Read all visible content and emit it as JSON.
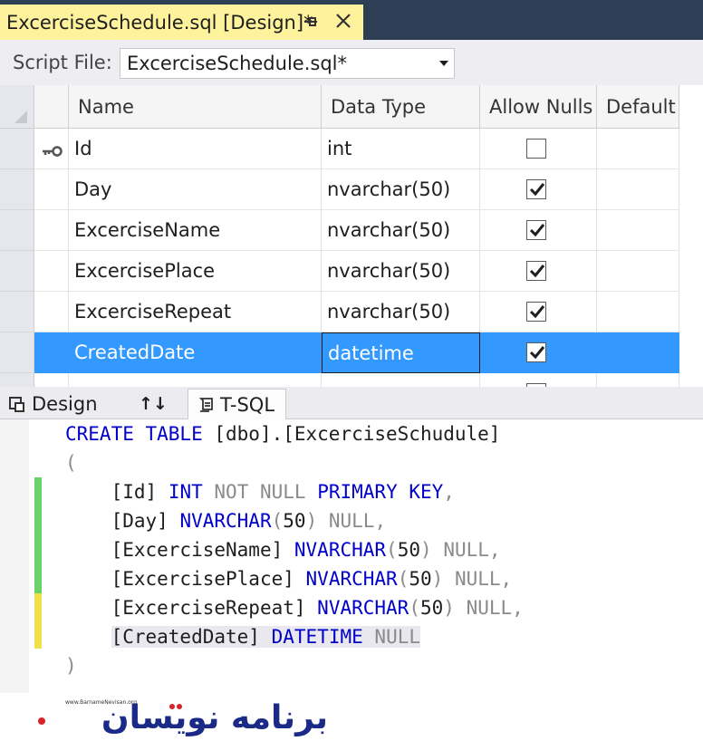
{
  "tab": {
    "title": "ExcerciseSchedule.sql [Design]*"
  },
  "script_file": {
    "label": "Script File:",
    "value": "ExcerciseSchedule.sql*"
  },
  "grid": {
    "columns": [
      "Name",
      "Data Type",
      "Allow Nulls",
      "Default"
    ],
    "rows": [
      {
        "name": "Id",
        "type": "int",
        "allow_nulls": false,
        "primary_key": true
      },
      {
        "name": "Day",
        "type": "nvarchar(50)",
        "allow_nulls": true
      },
      {
        "name": "ExcerciseName",
        "type": "nvarchar(50)",
        "allow_nulls": true
      },
      {
        "name": "ExcercisePlace",
        "type": "nvarchar(50)",
        "allow_nulls": true
      },
      {
        "name": "ExcerciseRepeat",
        "type": "nvarchar(50)",
        "allow_nulls": true
      },
      {
        "name": "CreatedDate",
        "type": "datetime",
        "allow_nulls": true,
        "selected": true
      }
    ]
  },
  "pane_tabs": {
    "design": "Design",
    "swap": "↑↓",
    "tsql": "T-SQL"
  },
  "sql": {
    "l1_kw": "CREATE TABLE",
    "l1_rest": "[dbo].[ExcerciseSchudule]",
    "l2": "(",
    "l3_col": "[Id]",
    "l3_type": "INT",
    "l3_null": "NOT NULL",
    "l3_pk": "PRIMARY KEY",
    "l3_end": ",",
    "l4_col": "[Day]",
    "l4_type": "NVARCHAR",
    "l4_len": "50",
    "l5_col": "[ExcerciseName]",
    "l5_type": "NVARCHAR",
    "l5_len": "50",
    "l6_col": "[ExcercisePlace]",
    "l6_type": "NVARCHAR",
    "l6_len": "50",
    "l7_col": "[ExcerciseRepeat]",
    "l7_type": "NVARCHAR",
    "l7_len": "50",
    "l8_col": "[CreatedDate]",
    "l8_type": "DATETIME",
    "l8_null": "NULL",
    "null_kw": "NULL",
    "close": ")"
  },
  "logo": {
    "tagline": "www.BarnameNevisan.org",
    "text": "برنامه نویسان"
  },
  "colors": {
    "tab_active": "#fff29d",
    "selection": "#3399ff",
    "keyword": "#0000c8",
    "change_saved": "#6ad26a",
    "change_unsaved": "#f0e04a"
  }
}
